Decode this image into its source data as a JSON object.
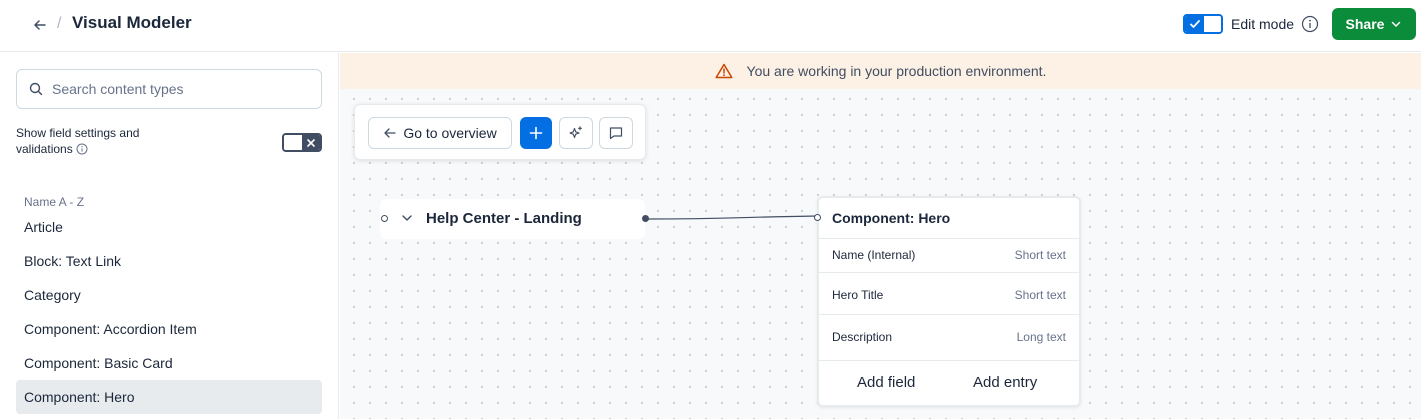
{
  "header": {
    "title": "Visual Modeler",
    "edit_mode_label": "Edit mode",
    "share_label": "Share"
  },
  "sidebar": {
    "search_placeholder": "Search content types",
    "field_settings_label": "Show field settings and validations",
    "sort_label": "Name A - Z",
    "items": [
      {
        "label": "Article"
      },
      {
        "label": "Block: Text Link"
      },
      {
        "label": "Category"
      },
      {
        "label": "Component: Accordion Item"
      },
      {
        "label": "Component: Basic Card"
      },
      {
        "label": "Component: Hero"
      }
    ],
    "active_item": "Component: Hero"
  },
  "canvas": {
    "banner_text": "You are working in your production environment.",
    "toolbar": {
      "overview_label": "Go to overview"
    },
    "node": {
      "label": "Help Center - Landing"
    },
    "card": {
      "title": "Component: Hero",
      "fields": [
        {
          "name": "Name (Internal)",
          "type": "Short text"
        },
        {
          "name": "Hero Title",
          "type": "Short text"
        },
        {
          "name": "Description",
          "type": "Long text"
        }
      ],
      "add_field_label": "Add field",
      "add_entry_label": "Add entry"
    }
  },
  "colors": {
    "accent": "#036fe3",
    "share": "#0b8c3a",
    "banner": "#fcf1e4",
    "warning": "#cc4500"
  }
}
